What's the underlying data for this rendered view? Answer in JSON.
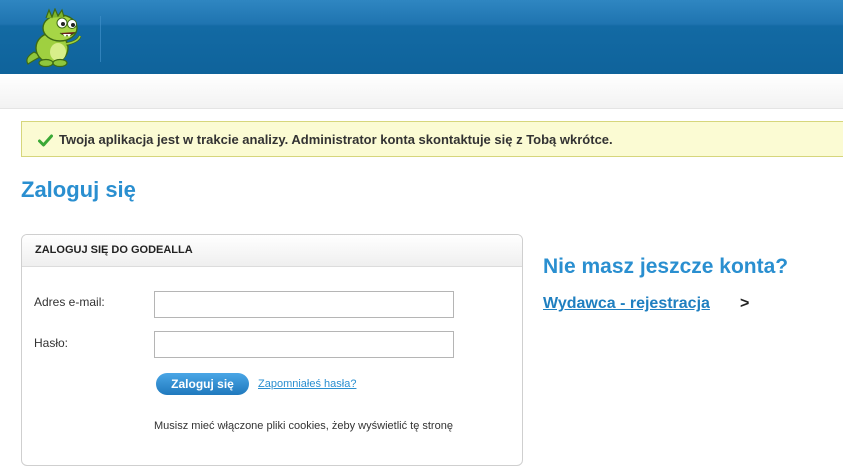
{
  "notice": {
    "message": "Twoja aplikacja jest w trakcie analizy. Administrator konta skontaktuje się z Tobą wkrótce."
  },
  "page": {
    "title": "Zaloguj się"
  },
  "login_panel": {
    "heading": "ZALOGUJ SIĘ DO GODEALLA",
    "email_label": "Adres e-mail:",
    "email_value": "",
    "password_label": "Hasło:",
    "password_value": "",
    "submit_label": "Zaloguj się",
    "forgot_link": "Zapomniałeś hasła?",
    "cookie_note": "Musisz mieć włączone pliki cookies, żeby wyświetlić tę stronę"
  },
  "signup": {
    "title": "Nie masz jeszcze konta?",
    "link": "Wydawca - rejestracja",
    "arrow": ">"
  },
  "icons": {
    "logo": "dinosaur-mascot-icon",
    "notice": "checkmark-icon"
  },
  "colors": {
    "header": "#136aa4",
    "accent": "#2a8fd0",
    "notice_bg": "#fbfbd3",
    "check": "#3aa835"
  }
}
